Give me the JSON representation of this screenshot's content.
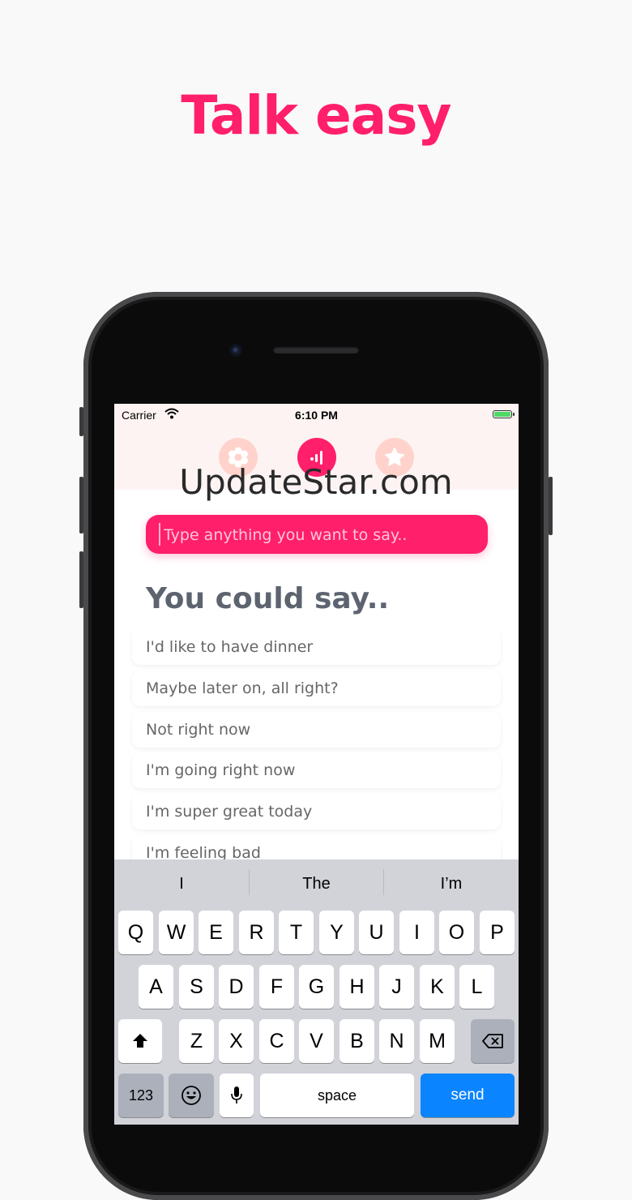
{
  "headline": "Talk easy",
  "watermark": "UpdateStar.com",
  "status_bar": {
    "carrier": "Carrier",
    "time": "6:10 PM"
  },
  "top_tabs": [
    {
      "icon": "flower-icon",
      "active": false
    },
    {
      "icon": "speech-waves-icon",
      "active": true
    },
    {
      "icon": "star-icon",
      "active": false
    }
  ],
  "input": {
    "placeholder": "Type anything you want to say..",
    "value": ""
  },
  "subheading": "You could say..",
  "suggestions": [
    "I'd like to have dinner",
    "Maybe later on, all right?",
    "Not right now",
    "I'm going right now",
    "I'm super great today",
    "I'm feeling bad"
  ],
  "keyboard": {
    "predictions": [
      "I",
      "The",
      "I’m"
    ],
    "row1": [
      "Q",
      "W",
      "E",
      "R",
      "T",
      "Y",
      "U",
      "I",
      "O",
      "P"
    ],
    "row2": [
      "A",
      "S",
      "D",
      "F",
      "G",
      "H",
      "J",
      "K",
      "L"
    ],
    "row3": [
      "Z",
      "X",
      "C",
      "V",
      "B",
      "N",
      "M"
    ],
    "numbers_label": "123",
    "space_label": "space",
    "send_label": "send"
  },
  "colors": {
    "accent": "#ff1f6b",
    "inactive_tab": "#ffd3cc",
    "send_key": "#0a84ff"
  }
}
